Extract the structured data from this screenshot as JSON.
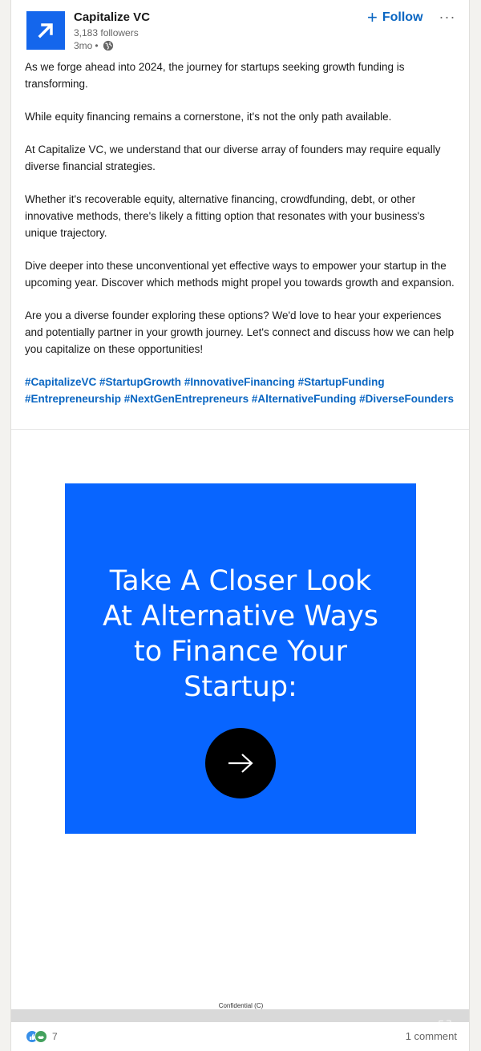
{
  "post": {
    "author": {
      "name": "Capitalize VC",
      "followers": "3,183 followers",
      "time": "3mo",
      "separator": "•"
    },
    "actions": {
      "follow_label": "Follow",
      "follow_plus": "+",
      "more_label": "···"
    },
    "paragraphs": [
      "As we forge ahead into 2024, the journey for startups seeking growth funding is transforming.",
      "While equity financing remains a cornerstone, it's not the only path available.",
      "At Capitalize VC, we understand that our diverse array of founders may require equally diverse financial strategies.",
      "Whether it's recoverable equity, alternative financing, crowdfunding, debt, or other innovative methods, there's likely a fitting option that resonates with your business's unique trajectory.",
      "Dive deeper into these unconventional yet effective ways to empower your startup in the upcoming year. Discover which methods might propel you towards growth and expansion.",
      "Are you a diverse founder exploring these options? We'd love to hear your experiences and potentially partner in your growth journey. Let's connect and discuss how we can help you capitalize on these opportunities!"
    ],
    "hashtags": [
      "#CapitalizeVC",
      "#StartupGrowth",
      "#InnovativeFinancing",
      "#StartupFunding",
      "#Entrepreneurship",
      "#NextGenEntrepreneurs",
      "#AlternativeFunding",
      "#DiverseFounders"
    ],
    "image": {
      "title_lines": [
        "Take A Closer Look",
        "At Alternative Ways",
        "to Finance Your",
        "Startup:"
      ],
      "background_color": "#0865ff",
      "confidential_label": "Confidential (C)",
      "slide_indicator": "⌐ ¬"
    },
    "footer": {
      "reaction_count": "7",
      "comments_label": "1 comment"
    }
  },
  "colors": {
    "brand_blue": "#0a66c2",
    "logo_blue": "#1466ec",
    "like_blue": "#378fe9",
    "support_green": "#44a15e"
  },
  "icons": {
    "logo": "arrow-up-right-logo",
    "visibility": "globe-icon",
    "arrow": "arrow-right-icon",
    "like": "like-reaction-icon",
    "support": "support-reaction-icon"
  }
}
